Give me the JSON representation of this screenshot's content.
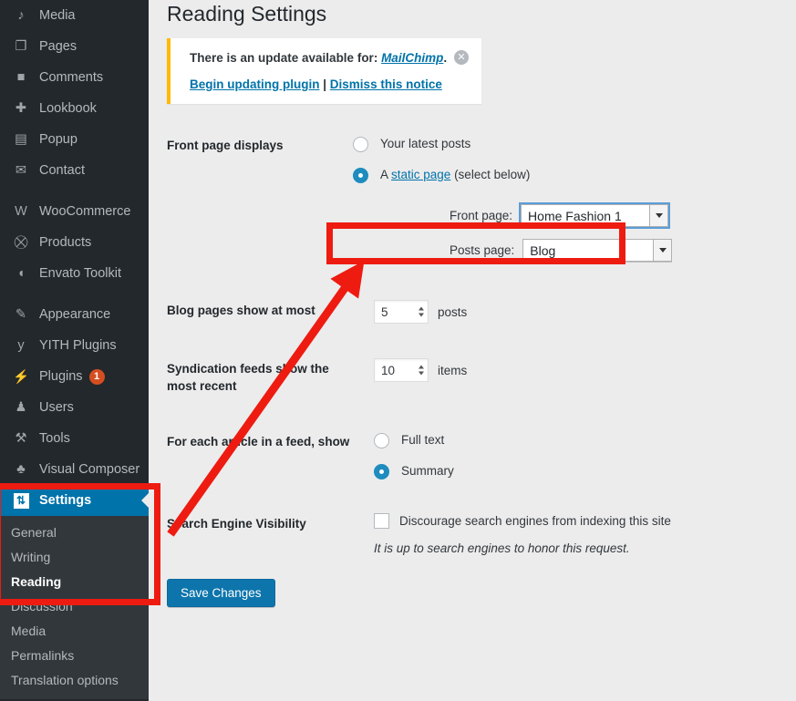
{
  "sidebar": {
    "items": [
      {
        "label": "Media",
        "icon": "media-icon",
        "glyph": "♪",
        "badge": null,
        "sep_after": false
      },
      {
        "label": "Pages",
        "icon": "pages-icon",
        "glyph": "❐",
        "badge": null,
        "sep_after": false
      },
      {
        "label": "Comments",
        "icon": "comments-icon",
        "glyph": "■",
        "badge": null,
        "sep_after": false
      },
      {
        "label": "Lookbook",
        "icon": "plus-square-icon",
        "glyph": "✚",
        "badge": null,
        "sep_after": false
      },
      {
        "label": "Popup",
        "icon": "popup-icon",
        "glyph": "▤",
        "badge": null,
        "sep_after": false
      },
      {
        "label": "Contact",
        "icon": "envelope-icon",
        "glyph": "✉",
        "badge": null,
        "sep_after": true
      },
      {
        "label": "WooCommerce",
        "icon": "woocommerce-icon",
        "glyph": "W",
        "badge": null,
        "sep_after": false
      },
      {
        "label": "Products",
        "icon": "cart-icon",
        "glyph": "⛒",
        "badge": null,
        "sep_after": false
      },
      {
        "label": "Envato Toolkit",
        "icon": "envato-leaf-icon",
        "glyph": "◖",
        "badge": null,
        "sep_after": true
      },
      {
        "label": "Appearance",
        "icon": "paintbrush-icon",
        "glyph": "✎",
        "badge": null,
        "sep_after": false
      },
      {
        "label": "YITH Plugins",
        "icon": "yith-icon",
        "glyph": "y",
        "badge": null,
        "sep_after": false
      },
      {
        "label": "Plugins",
        "icon": "plug-icon",
        "glyph": "⚡",
        "badge": "1",
        "sep_after": false
      },
      {
        "label": "Users",
        "icon": "user-icon",
        "glyph": "♟",
        "badge": null,
        "sep_after": false
      },
      {
        "label": "Tools",
        "icon": "wrench-icon",
        "glyph": "⚒",
        "badge": null,
        "sep_after": false
      },
      {
        "label": "Visual Composer",
        "icon": "visual-composer-icon",
        "glyph": "♣",
        "badge": null,
        "sep_after": false
      }
    ],
    "settings": {
      "label": "Settings",
      "icon": "settings-sliders-icon",
      "glyph": "⇅",
      "current": true
    },
    "submenu": [
      {
        "label": "General",
        "current": false
      },
      {
        "label": "Writing",
        "current": false
      },
      {
        "label": "Reading",
        "current": true
      },
      {
        "label": "Discussion",
        "current": false
      },
      {
        "label": "Media",
        "current": false
      },
      {
        "label": "Permalinks",
        "current": false
      },
      {
        "label": "Translation options",
        "current": false
      }
    ]
  },
  "page": {
    "title": "Reading Settings"
  },
  "notice": {
    "text_before": "There is an update available for: ",
    "plugin_name": "MailChimp",
    "text_after": ".",
    "action_update": "Begin updating plugin",
    "separator": "|",
    "action_dismiss": "Dismiss this notice",
    "close_glyph": "✕",
    "accent_color": "#ffb900"
  },
  "form": {
    "front_page_displays": {
      "label": "Front page displays",
      "options": [
        {
          "label": "Your latest posts",
          "checked": false
        },
        {
          "label_prefix": "A ",
          "link_text": "static page",
          "label_suffix": " (select below)",
          "checked": true
        }
      ],
      "front_page": {
        "label": "Front page:",
        "value": "Home Fashion 1",
        "focused": true
      },
      "posts_page": {
        "label": "Posts page:",
        "value": "Blog",
        "focused": false
      }
    },
    "blog_pages": {
      "label": "Blog pages show at most",
      "value": "5",
      "unit": "posts"
    },
    "syndication_feeds": {
      "label": "Syndication feeds show the most recent",
      "value": "10",
      "unit": "items"
    },
    "feed_article": {
      "label": "For each article in a feed, show",
      "options": [
        {
          "label": "Full text",
          "checked": false
        },
        {
          "label": "Summary",
          "checked": true
        }
      ]
    },
    "search_visibility": {
      "label": "Search Engine Visibility",
      "checkbox_label": "Discourage search engines from indexing this site",
      "checked": false,
      "hint": "It is up to search engines to honor this request."
    },
    "submit": {
      "label": "Save Changes"
    }
  },
  "annotations": {
    "highlight_color": "#ee1b11",
    "box_front_page_select": "red-rectangle-around-front-page-dropdown",
    "box_settings_menu": "red-rectangle-around-settings-reading-menu",
    "arrow": "red-arrow-pointing-to-front-page-dropdown"
  }
}
